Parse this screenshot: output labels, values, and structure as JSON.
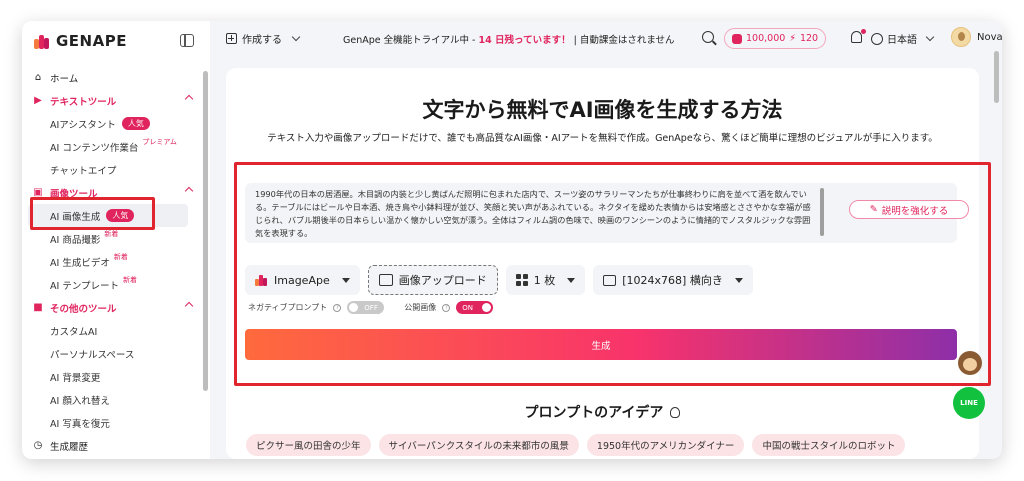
{
  "brand": {
    "name": "GENAPE"
  },
  "topbar": {
    "create_label": "作成する",
    "trial_prefix": "GenApe 全機能トライアル中 -",
    "trial_days": "14 日残っています！",
    "trial_suffix": "| 自動課金はされません",
    "credits_main": "100,000",
    "credits_bolt": "120",
    "language": "日本語",
    "username": "Nova"
  },
  "sidebar": {
    "home": "ホーム",
    "text_tools": "テキストツール",
    "ai_assistant": "AIアシスタント",
    "ai_content_studio": "AI コンテンツ作業台",
    "premium": "プレミアム",
    "chat_ape": "チャットエイプ",
    "image_tools": "画像ツール",
    "ai_image_gen": "AI 画像生成",
    "ai_product_shot": "AI 商品撮影",
    "ai_video": "AI 生成ビデオ",
    "ai_template": "AI テンプレート",
    "other_tools": "その他のツール",
    "custom_ai": "カスタムAI",
    "personal_space": "パーソナルスペース",
    "ai_bg_change": "AI 背景変更",
    "ai_face_swap": "AI 顔入れ替え",
    "ai_photo_restore": "AI 写真を復元",
    "history": "生成履歴",
    "badge_hot": "人気",
    "badge_new": "新着"
  },
  "main": {
    "title": "文字から無料でAI画像を生成する方法",
    "subtitle": "テキスト入力や画像アップロードだけで、誰でも高品質なAI画像・AIアートを無料で作成。GenApeなら、驚くほど簡単に理想のビジュアルが手に入ります。",
    "prompt_text": "1990年代の日本の居酒屋。木目調の内装と少し黄ばんだ照明に包まれた店内で、スーツ姿のサラリーマンたちが仕事終わりに肩を並べて酒を飲んでいる。テーブルにはビールや日本酒、焼き鳥や小鉢料理が並び、笑顔と笑い声があふれている。ネクタイを緩めた表情からは安堵感とささやかな幸福が感じられ、バブル期後半の日本らしい温かく懐かしい空気が漂う。全体はフィルム調の色味で、映画のワンシーンのように情緒的でノスタルジックな雰囲気を表現する。",
    "enhance_label": "説明を強化する",
    "model_label": "ImageApe",
    "upload_label": "画像アップロード",
    "count_label": "1 枚",
    "size_label": "[1024x768] 横向き",
    "negative_prompt": "ネガティブプロンプト",
    "negative_state": "OFF",
    "public_image": "公開画像",
    "public_state": "ON",
    "generate_label": "生成",
    "ideas_title": "プロンプトのアイデア",
    "ideas": [
      "ピクサー風の田舎の少年",
      "サイバーパンクスタイルの未来都市の風景",
      "1950年代のアメリカンダイナー",
      "中国の戦士スタイルのロボット"
    ]
  },
  "float": {
    "line_label": "LINE"
  },
  "colors": {
    "accent": "#e0245e",
    "highlight": "#e1252f",
    "line_green": "#12c13e"
  }
}
